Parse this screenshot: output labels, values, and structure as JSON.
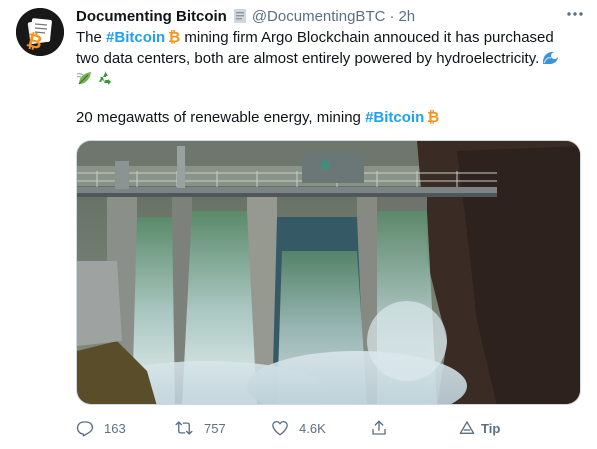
{
  "author": {
    "display_name": "Documenting Bitcoin",
    "handle": "@DocumentingBTC",
    "separator": "·",
    "time": "2h",
    "avatar_icon": "bitcoin-logo-avatar",
    "badge_icon": "document-icon"
  },
  "tweet": {
    "line1_prefix": "The ",
    "hashtag1": "#Bitcoin",
    "line1_rest": " mining firm Argo Blockchain annouced it has purchased two data centers, both are almost entirely powered by hydroelectricity.",
    "emojis": [
      "water-wave-icon",
      "leaf-wind-icon",
      "recycle-icon"
    ],
    "line3_prefix": "20 megawatts of renewable energy, mining ",
    "hashtag2": "#Bitcoin"
  },
  "media": {
    "description_icon": "dam-photo"
  },
  "actions": {
    "reply_count": "163",
    "retweet_count": "757",
    "like_count": "4.6K",
    "tip_label": "Tip"
  },
  "colors": {
    "hashtag": "#1da1f2",
    "muted": "#5b7083",
    "bitcoin_orange": "#f7931a"
  }
}
